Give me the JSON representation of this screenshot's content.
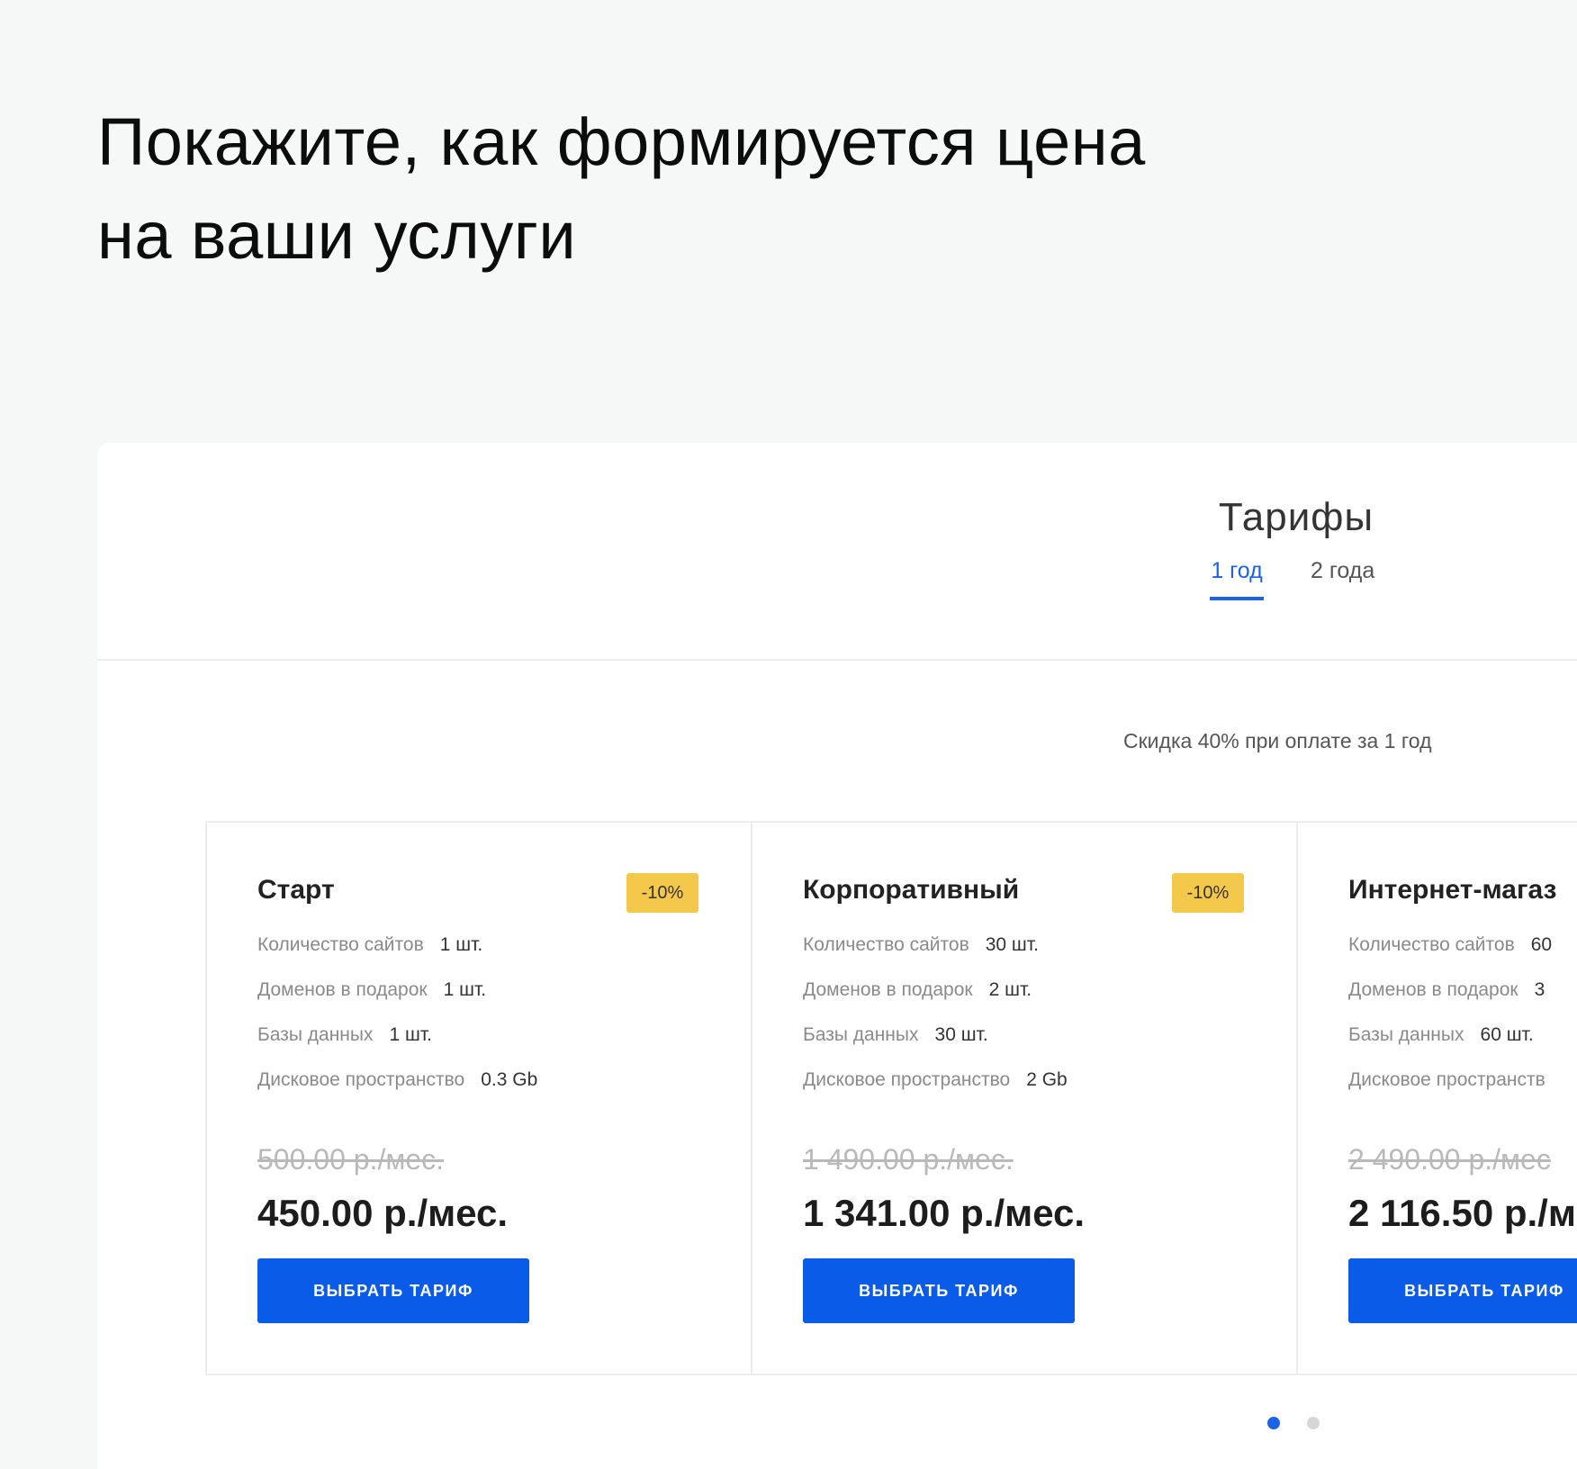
{
  "headline": {
    "line1": "Покажите, как формируется цена",
    "line2": "на ваши услуги"
  },
  "pricing": {
    "title": "Тарифы",
    "tabs": [
      {
        "label": "1 год",
        "active": true
      },
      {
        "label": "2 года",
        "active": false
      }
    ],
    "discount_note": "Скидка 40% при оплате за 1 год",
    "accent_color": "#0a5ce8",
    "badge_color": "#f3c84b",
    "plans": [
      {
        "name": "Старт",
        "badge": "-10%",
        "features": [
          {
            "label": "Количество сайтов",
            "value": "1 шт."
          },
          {
            "label": "Доменов в подарок",
            "value": "1 шт."
          },
          {
            "label": "Базы данных",
            "value": "1 шт."
          },
          {
            "label": "Дисковое пространство",
            "value": "0.3 Gb"
          }
        ],
        "old_price": "500.00 р./мес.",
        "price": "450.00 р./мес.",
        "button": "ВЫБРАТЬ ТАРИФ"
      },
      {
        "name": "Корпоративный",
        "badge": "-10%",
        "features": [
          {
            "label": "Количество сайтов",
            "value": "30 шт."
          },
          {
            "label": "Доменов в подарок",
            "value": "2 шт."
          },
          {
            "label": "Базы данных",
            "value": "30 шт."
          },
          {
            "label": "Дисковое пространство",
            "value": "2 Gb"
          }
        ],
        "old_price": "1 490.00 р./мес.",
        "price": "1 341.00 р./мес.",
        "button": "ВЫБРАТЬ ТАРИФ"
      },
      {
        "name": "Интернет-магаз",
        "badge": "",
        "features": [
          {
            "label": "Количество сайтов",
            "value": "60"
          },
          {
            "label": "Доменов в подарок",
            "value": "3"
          },
          {
            "label": "Базы данных",
            "value": "60 шт."
          },
          {
            "label": "Дисковое пространств",
            "value": ""
          }
        ],
        "old_price": "2 490.00 р./мес",
        "price": "2 116.50 р./м",
        "button": "ВЫБРАТЬ ТАРИФ"
      }
    ],
    "pagination": {
      "current": 1,
      "total": 2
    }
  }
}
